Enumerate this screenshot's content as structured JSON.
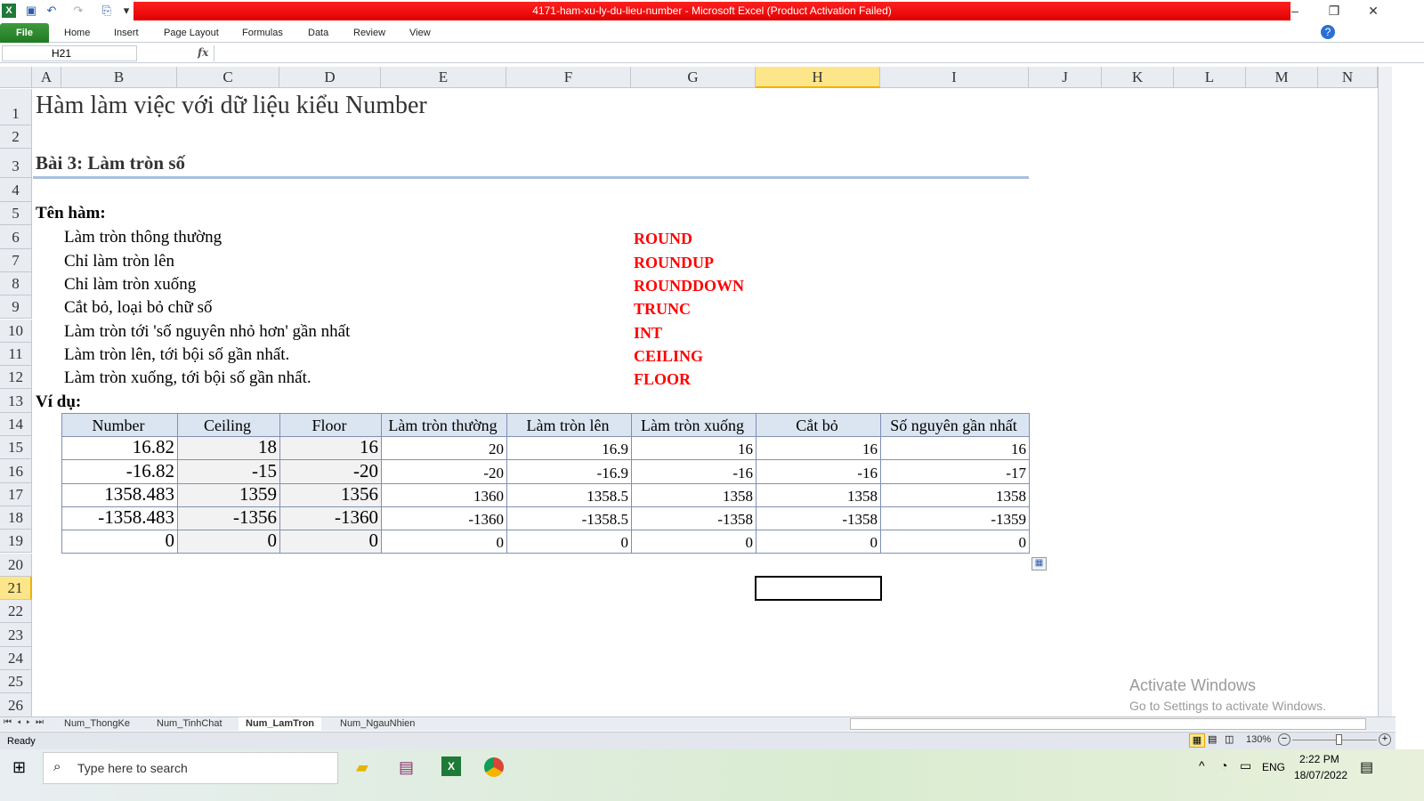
{
  "window": {
    "title": "4171-ham-xu-ly-du-lieu-number - Microsoft Excel (Product Activation Failed)"
  },
  "ribbon": {
    "file": "File",
    "tabs": [
      "Home",
      "Insert",
      "Page Layout",
      "Formulas",
      "Data",
      "Review",
      "View"
    ]
  },
  "formula_bar": {
    "name_box": "H21",
    "fx": "fx",
    "formula": ""
  },
  "columns": [
    "A",
    "B",
    "C",
    "D",
    "E",
    "F",
    "G",
    "H",
    "I",
    "J",
    "K",
    "L",
    "M",
    "N"
  ],
  "selected_cell": "H21",
  "sheet": {
    "title": "Hàm làm việc với dữ liệu kiểu Number",
    "subtitle": "Bài 3: Làm tròn số",
    "functions_heading": "Tên hàm:",
    "functions": [
      {
        "desc": "Làm tròn thông thường",
        "name": "ROUND"
      },
      {
        "desc": "Chỉ làm tròn lên",
        "name": "ROUNDUP"
      },
      {
        "desc": "Chỉ làm tròn xuống",
        "name": "ROUNDDOWN"
      },
      {
        "desc": "Cắt bỏ, loại bỏ chữ số",
        "name": "TRUNC"
      },
      {
        "desc": "Làm tròn tới 'số nguyên nhỏ hơn' gần nhất",
        "name": "INT"
      },
      {
        "desc": "Làm tròn lên, tới bội số gần nhất.",
        "name": "CEILING"
      },
      {
        "desc": "Làm tròn xuống, tới bội số gần nhất.",
        "name": "FLOOR"
      }
    ],
    "example_heading": "Ví dụ:",
    "table": {
      "headers": [
        "Number",
        "Ceiling",
        "Floor",
        "Làm tròn thường",
        "Làm tròn lên",
        "Làm tròn xuống",
        "Cắt bỏ",
        "Số nguyên gần nhất"
      ],
      "rows": [
        [
          "16.82",
          "18",
          "16",
          "20",
          "16.9",
          "16",
          "16",
          "16"
        ],
        [
          "-16.82",
          "-15",
          "-20",
          "-20",
          "-16.9",
          "-16",
          "-16",
          "-17"
        ],
        [
          "1358.483",
          "1359",
          "1356",
          "1360",
          "1358.5",
          "1358",
          "1358",
          "1358"
        ],
        [
          "-1358.483",
          "-1356",
          "-1360",
          "-1360",
          "-1358.5",
          "-1358",
          "-1358",
          "-1359"
        ],
        [
          "0",
          "0",
          "0",
          "0",
          "0",
          "0",
          "0",
          "0"
        ]
      ]
    }
  },
  "sheet_tabs": [
    "Num_ThongKe",
    "Num_TinhChat",
    "Num_LamTron",
    "Num_NgauNhien"
  ],
  "active_sheet": "Num_LamTron",
  "status": {
    "mode": "Ready",
    "zoom": "130%"
  },
  "watermark": {
    "line1": "Activate Windows",
    "line2": "Go to Settings to activate Windows."
  },
  "taskbar": {
    "search_placeholder": "Type here to search",
    "lang": "ENG",
    "time": "2:22 PM",
    "date": "18/07/2022"
  },
  "colors": {
    "accent_red": "#ff0000",
    "header_fill": "#dbe5f1",
    "selection": "#fde58a"
  }
}
